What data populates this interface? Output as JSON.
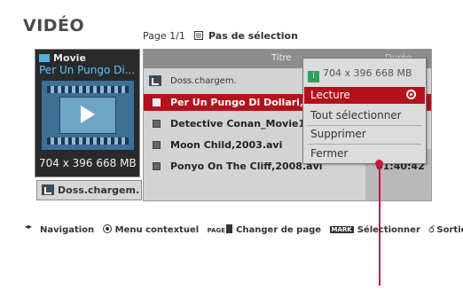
{
  "header": {
    "title": "VIDÉO",
    "page_info": "Page 1/1",
    "selection_status": "Pas de sélection"
  },
  "preview": {
    "category": "Movie",
    "file_name": "Per Un Pungo Di...",
    "resolution_size": "704 x 396  668 MB"
  },
  "up_folder_button": {
    "label": "Doss.chargem."
  },
  "file_list": {
    "columns": {
      "title": "Titre",
      "duration": "Durée"
    },
    "folder_row": "Doss.chargem.",
    "rows": [
      {
        "name": "Per Un Pungo Di Dollari,1964.avi",
        "duration": "",
        "selected": true
      },
      {
        "name": "Detective Conan_Movie13-1.avi",
        "duration": ""
      },
      {
        "name": "Moon Child,2003.avi",
        "duration": ""
      },
      {
        "name": "Ponyo On The Cliff,2008.avi",
        "duration": "01:40:42"
      }
    ]
  },
  "context_menu": {
    "info_badge": "i",
    "info": "704 x 396  668 MB",
    "items": [
      "Lecture",
      "Tout sélectionner",
      "Supprimer",
      "Fermer"
    ],
    "active_index": 0
  },
  "legend": {
    "navigation": "Navigation",
    "context_menu": "Menu contextuel",
    "page_key": "PAGE",
    "change_page": "Changer de page",
    "mark_key": "MARK",
    "select": "Sélectionner",
    "exit": "Sortie"
  },
  "colors": {
    "accent_red": "#b3121c",
    "pointer": "#c8143c",
    "file_name_blue": "#5cc6ff"
  }
}
